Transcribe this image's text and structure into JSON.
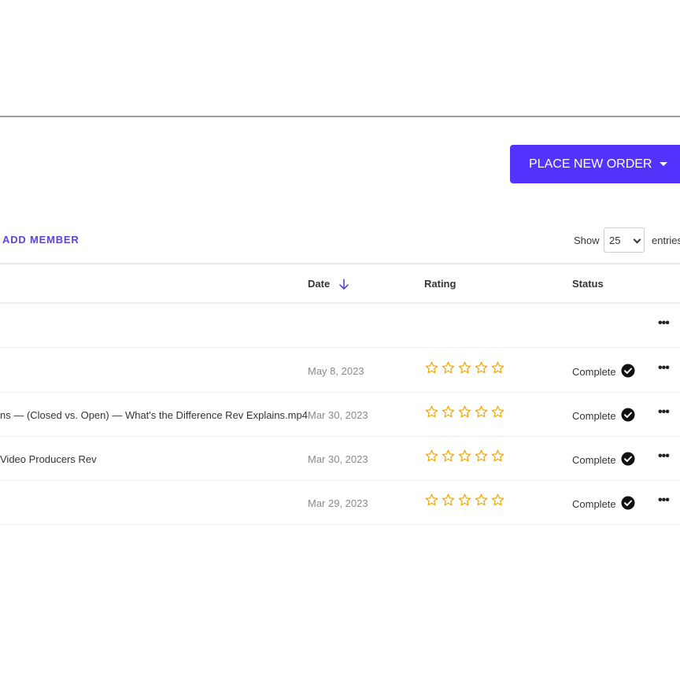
{
  "toolbar": {
    "place_order_label": "PLACE NEW ORDER",
    "add_member_label": "ADD MEMBER",
    "show_label": "Show",
    "entries_value": "25",
    "entries_label": "entries"
  },
  "table": {
    "headers": {
      "date": "Date",
      "rating": "Rating",
      "status": "Status"
    },
    "rows": [
      {
        "name": "",
        "date": "",
        "rating": null,
        "status": ""
      },
      {
        "name": "",
        "date": "May 8, 2023",
        "rating": 0,
        "status": "Complete"
      },
      {
        "name": "ns — (Closed vs. Open) — What's the Difference Rev Explains.mp4",
        "date": "Mar 30, 2023",
        "rating": 0,
        "status": "Complete"
      },
      {
        "name": "Video Producers Rev",
        "date": "Mar 30, 2023",
        "rating": 0,
        "status": "Complete"
      },
      {
        "name": "",
        "date": "Mar 29, 2023",
        "rating": 0,
        "status": "Complete"
      }
    ],
    "max_rating": 5
  },
  "icons": {
    "sort": "arrow-down-icon",
    "star": "star-outline-icon",
    "status": "check-circle-icon",
    "more": "more-horizontal-icon"
  },
  "colors": {
    "accent": "#5533ff",
    "accent_text": "#5b45d6",
    "star": "#f2a900",
    "muted_text": "#8a8a8a"
  }
}
